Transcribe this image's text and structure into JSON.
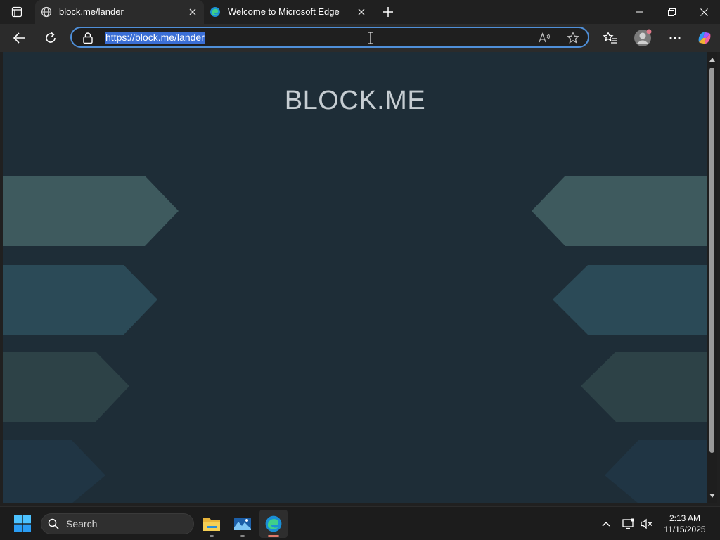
{
  "browser": {
    "tabs": [
      {
        "title": "block.me/lander",
        "active": true,
        "icon": "globe-icon"
      },
      {
        "title": "Welcome to Microsoft Edge",
        "active": false,
        "icon": "edge-icon"
      }
    ],
    "address_url": "https://block.me/lander"
  },
  "page": {
    "site_title": "BLOCK.ME",
    "background_color": "#1e2d37",
    "shape_colors": [
      "#3e5a5e",
      "#2b4a57",
      "#2d4247",
      "#203544"
    ]
  },
  "taskbar": {
    "search_label": "Search",
    "apps": [
      "file-explorer-icon",
      "photos-icon",
      "edge-icon"
    ],
    "clock_time": "2:13 AM",
    "clock_date": "11/15/2025"
  },
  "colors": {
    "accent": "#4f8fd8",
    "selection": "#3b6fd6",
    "chrome_dark": "#202020",
    "toolbar": "#2b2b2b"
  }
}
